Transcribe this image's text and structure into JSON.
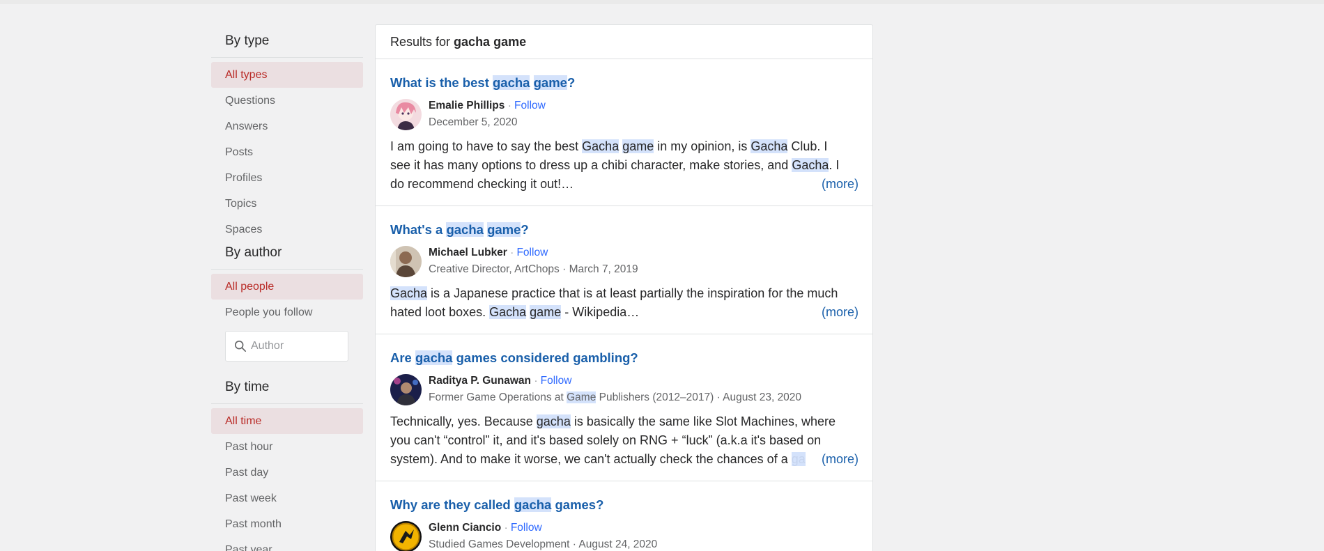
{
  "sidebar": {
    "by_type": {
      "title": "By type",
      "items": [
        "All types",
        "Questions",
        "Answers",
        "Posts",
        "Profiles",
        "Topics",
        "Spaces"
      ]
    },
    "by_author": {
      "title": "By author",
      "items": [
        "All people",
        "People you follow"
      ],
      "search_placeholder": "Author"
    },
    "by_time": {
      "title": "By time",
      "items": [
        "All time",
        "Past hour",
        "Past day",
        "Past week",
        "Past month",
        "Past year"
      ]
    }
  },
  "results": {
    "prefix": "Results for",
    "query": "gacha game",
    "items": [
      {
        "title_parts": [
          "What is the best ",
          "gacha",
          " ",
          "game",
          "?"
        ],
        "author": "Emalie Phillips",
        "follow": "Follow",
        "credential": "December 5, 2020",
        "body_l1_parts": [
          "I am going to have to say the best ",
          "Gacha",
          " ",
          "game",
          " in my opinion, is ",
          "Gacha",
          " Club. I"
        ],
        "body_l2_parts": [
          "see it has many options to dress up a chibi character, make stories, and ",
          "Gacha",
          ". I"
        ],
        "body_l3": "do recommend checking it out!…",
        "more": "(more)"
      },
      {
        "title_parts": [
          "What's a ",
          "gacha",
          " ",
          "game",
          "?"
        ],
        "author": "Michael Lubker",
        "follow": "Follow",
        "credential": "Creative Director, ArtChops · March 7, 2019",
        "body_l1_parts": [
          "Gacha",
          " is a Japanese practice that is at least partially the inspiration for the much"
        ],
        "body_l2_parts": [
          "hated loot boxes. ",
          "Gacha",
          " ",
          "game",
          " - Wikipedia…"
        ],
        "more": "(more)"
      },
      {
        "title_parts": [
          "Are ",
          "gacha",
          " games considered gambling?"
        ],
        "author": "Raditya P. Gunawan",
        "follow": "Follow",
        "credential_parts": [
          "Former Game Operations at ",
          "Game",
          " Publishers (2012–2017) · August 23, 2020"
        ],
        "body_l1_parts": [
          "Technically, yes. Because ",
          "gacha",
          " is basically the same like Slot Machines, where"
        ],
        "body_l2": "you can't “control” it, and it's based solely on RNG + “luck” (a.k.a it's based on",
        "body_l3_parts": [
          "system). And to make it worse, we can't actually check the chances of a ",
          "ga"
        ],
        "more": "(more)"
      },
      {
        "title_parts": [
          "Why are they called ",
          "gacha",
          " games?"
        ],
        "author": "Glenn Ciancio",
        "follow": "Follow",
        "credential": "Studied Games Development · August 24, 2020"
      }
    ]
  },
  "colors": {
    "link_blue": "#195faa",
    "follow_blue": "#2e69ff",
    "highlight": "#d4e2fb",
    "active_bg": "#ebdfe1",
    "active_text": "#b92b27"
  }
}
